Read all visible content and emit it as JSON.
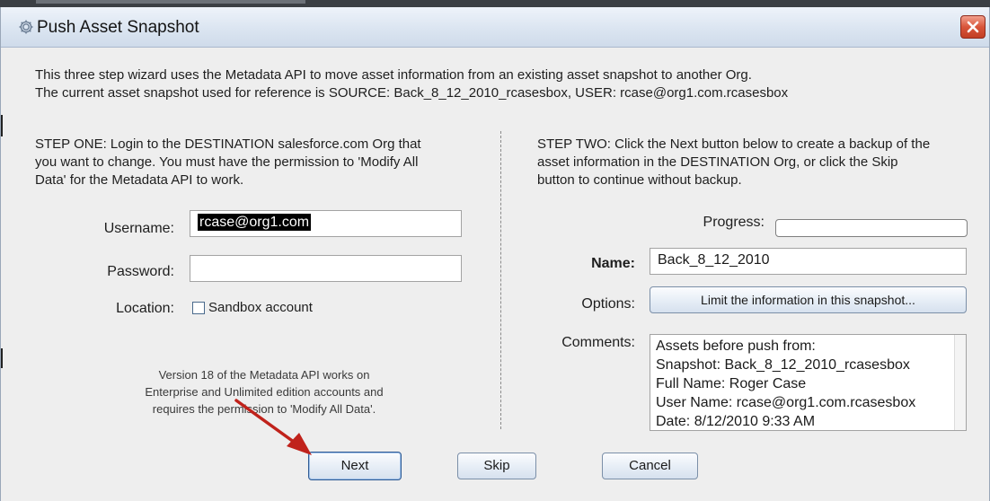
{
  "window": {
    "title": "Push Asset Snapshot",
    "close_label": "Close"
  },
  "intro": {
    "line1": "This three step wizard uses the Metadata API to move asset information from an existing asset snapshot to another Org.",
    "line2": "The current asset snapshot used for reference is SOURCE: Back_8_12_2010_rcasesbox, USER: rcase@org1.com.rcasesbox"
  },
  "step_one": {
    "text": [
      "STEP ONE: Login to the DESTINATION salesforce.com Org that",
      "you want to change. You must have the permission to 'Modify All",
      "Data' for the Metadata API to work."
    ],
    "username_label": "Username:",
    "username_value": "rcase@org1.com",
    "password_label": "Password:",
    "password_value": "",
    "location_label": "Location:",
    "sandbox_label": "Sandbox account",
    "sandbox_checked": false,
    "note": [
      "Version 18 of the Metadata API works on",
      "Enterprise and Unlimited edition accounts and",
      "requires the permission to 'Modify All Data'."
    ]
  },
  "step_two": {
    "text": [
      "STEP TWO: Click the Next button below to create a backup of the",
      "asset information in the DESTINATION Org, or click the Skip",
      "button to continue without backup."
    ],
    "progress_label": "Progress:",
    "progress_value": 0,
    "name_label": "Name:",
    "name_value": "Back_8_12_2010",
    "options_label": "Options:",
    "options_button": "Limit the information in this snapshot...",
    "comments_label": "Comments:",
    "comments_lines": [
      "Assets before push from:",
      "Snapshot: Back_8_12_2010_rcasesbox",
      "Full Name: Roger Case",
      "User Name: rcase@org1.com.rcasesbox",
      "Date: 8/12/2010 9:33 AM"
    ]
  },
  "footer": {
    "next_label": "Next",
    "skip_label": "Skip",
    "cancel_label": "Cancel"
  },
  "colors": {
    "annotation_arrow": "#c0221b",
    "close_button": "#d8553a",
    "titlebar": "#dbe5f1"
  },
  "icons": {
    "title": "gear-icon",
    "close": "close-icon",
    "arrow": "annotation-arrow"
  }
}
